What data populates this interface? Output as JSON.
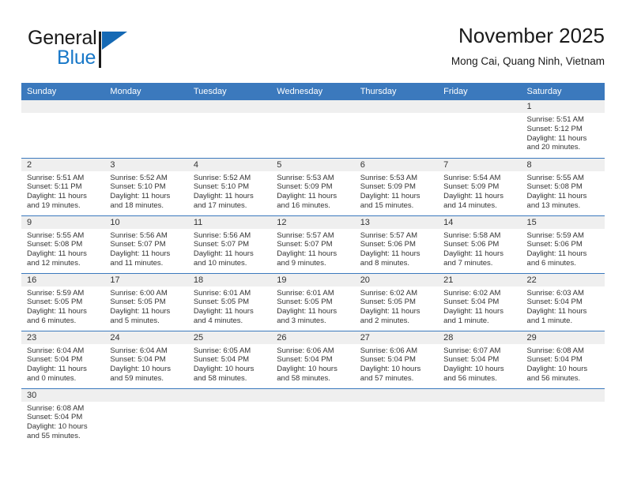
{
  "brand": {
    "name_top": "General",
    "name_bottom": "Blue",
    "logo_icon": "blue-triangle-logo",
    "accent_color": "#1878c8"
  },
  "header": {
    "title": "November 2025",
    "subtitle": "Mong Cai, Quang Ninh, Vietnam"
  },
  "calendar": {
    "header_bg": "#3b79bd",
    "daynum_bg": "#efefef",
    "weekdays": [
      "Sunday",
      "Monday",
      "Tuesday",
      "Wednesday",
      "Thursday",
      "Friday",
      "Saturday"
    ],
    "weeks": [
      [
        {
          "day": "",
          "blank": true,
          "sunrise": "",
          "sunset": "",
          "daylight_1": "",
          "daylight_2": ""
        },
        {
          "day": "",
          "blank": true,
          "sunrise": "",
          "sunset": "",
          "daylight_1": "",
          "daylight_2": ""
        },
        {
          "day": "",
          "blank": true,
          "sunrise": "",
          "sunset": "",
          "daylight_1": "",
          "daylight_2": ""
        },
        {
          "day": "",
          "blank": true,
          "sunrise": "",
          "sunset": "",
          "daylight_1": "",
          "daylight_2": ""
        },
        {
          "day": "",
          "blank": true,
          "sunrise": "",
          "sunset": "",
          "daylight_1": "",
          "daylight_2": ""
        },
        {
          "day": "",
          "blank": true,
          "sunrise": "",
          "sunset": "",
          "daylight_1": "",
          "daylight_2": ""
        },
        {
          "day": "1",
          "blank": false,
          "sunrise": "Sunrise: 5:51 AM",
          "sunset": "Sunset: 5:12 PM",
          "daylight_1": "Daylight: 11 hours",
          "daylight_2": "and 20 minutes."
        }
      ],
      [
        {
          "day": "2",
          "blank": false,
          "sunrise": "Sunrise: 5:51 AM",
          "sunset": "Sunset: 5:11 PM",
          "daylight_1": "Daylight: 11 hours",
          "daylight_2": "and 19 minutes."
        },
        {
          "day": "3",
          "blank": false,
          "sunrise": "Sunrise: 5:52 AM",
          "sunset": "Sunset: 5:10 PM",
          "daylight_1": "Daylight: 11 hours",
          "daylight_2": "and 18 minutes."
        },
        {
          "day": "4",
          "blank": false,
          "sunrise": "Sunrise: 5:52 AM",
          "sunset": "Sunset: 5:10 PM",
          "daylight_1": "Daylight: 11 hours",
          "daylight_2": "and 17 minutes."
        },
        {
          "day": "5",
          "blank": false,
          "sunrise": "Sunrise: 5:53 AM",
          "sunset": "Sunset: 5:09 PM",
          "daylight_1": "Daylight: 11 hours",
          "daylight_2": "and 16 minutes."
        },
        {
          "day": "6",
          "blank": false,
          "sunrise": "Sunrise: 5:53 AM",
          "sunset": "Sunset: 5:09 PM",
          "daylight_1": "Daylight: 11 hours",
          "daylight_2": "and 15 minutes."
        },
        {
          "day": "7",
          "blank": false,
          "sunrise": "Sunrise: 5:54 AM",
          "sunset": "Sunset: 5:09 PM",
          "daylight_1": "Daylight: 11 hours",
          "daylight_2": "and 14 minutes."
        },
        {
          "day": "8",
          "blank": false,
          "sunrise": "Sunrise: 5:55 AM",
          "sunset": "Sunset: 5:08 PM",
          "daylight_1": "Daylight: 11 hours",
          "daylight_2": "and 13 minutes."
        }
      ],
      [
        {
          "day": "9",
          "blank": false,
          "sunrise": "Sunrise: 5:55 AM",
          "sunset": "Sunset: 5:08 PM",
          "daylight_1": "Daylight: 11 hours",
          "daylight_2": "and 12 minutes."
        },
        {
          "day": "10",
          "blank": false,
          "sunrise": "Sunrise: 5:56 AM",
          "sunset": "Sunset: 5:07 PM",
          "daylight_1": "Daylight: 11 hours",
          "daylight_2": "and 11 minutes."
        },
        {
          "day": "11",
          "blank": false,
          "sunrise": "Sunrise: 5:56 AM",
          "sunset": "Sunset: 5:07 PM",
          "daylight_1": "Daylight: 11 hours",
          "daylight_2": "and 10 minutes."
        },
        {
          "day": "12",
          "blank": false,
          "sunrise": "Sunrise: 5:57 AM",
          "sunset": "Sunset: 5:07 PM",
          "daylight_1": "Daylight: 11 hours",
          "daylight_2": "and 9 minutes."
        },
        {
          "day": "13",
          "blank": false,
          "sunrise": "Sunrise: 5:57 AM",
          "sunset": "Sunset: 5:06 PM",
          "daylight_1": "Daylight: 11 hours",
          "daylight_2": "and 8 minutes."
        },
        {
          "day": "14",
          "blank": false,
          "sunrise": "Sunrise: 5:58 AM",
          "sunset": "Sunset: 5:06 PM",
          "daylight_1": "Daylight: 11 hours",
          "daylight_2": "and 7 minutes."
        },
        {
          "day": "15",
          "blank": false,
          "sunrise": "Sunrise: 5:59 AM",
          "sunset": "Sunset: 5:06 PM",
          "daylight_1": "Daylight: 11 hours",
          "daylight_2": "and 6 minutes."
        }
      ],
      [
        {
          "day": "16",
          "blank": false,
          "sunrise": "Sunrise: 5:59 AM",
          "sunset": "Sunset: 5:05 PM",
          "daylight_1": "Daylight: 11 hours",
          "daylight_2": "and 6 minutes."
        },
        {
          "day": "17",
          "blank": false,
          "sunrise": "Sunrise: 6:00 AM",
          "sunset": "Sunset: 5:05 PM",
          "daylight_1": "Daylight: 11 hours",
          "daylight_2": "and 5 minutes."
        },
        {
          "day": "18",
          "blank": false,
          "sunrise": "Sunrise: 6:01 AM",
          "sunset": "Sunset: 5:05 PM",
          "daylight_1": "Daylight: 11 hours",
          "daylight_2": "and 4 minutes."
        },
        {
          "day": "19",
          "blank": false,
          "sunrise": "Sunrise: 6:01 AM",
          "sunset": "Sunset: 5:05 PM",
          "daylight_1": "Daylight: 11 hours",
          "daylight_2": "and 3 minutes."
        },
        {
          "day": "20",
          "blank": false,
          "sunrise": "Sunrise: 6:02 AM",
          "sunset": "Sunset: 5:05 PM",
          "daylight_1": "Daylight: 11 hours",
          "daylight_2": "and 2 minutes."
        },
        {
          "day": "21",
          "blank": false,
          "sunrise": "Sunrise: 6:02 AM",
          "sunset": "Sunset: 5:04 PM",
          "daylight_1": "Daylight: 11 hours",
          "daylight_2": "and 1 minute."
        },
        {
          "day": "22",
          "blank": false,
          "sunrise": "Sunrise: 6:03 AM",
          "sunset": "Sunset: 5:04 PM",
          "daylight_1": "Daylight: 11 hours",
          "daylight_2": "and 1 minute."
        }
      ],
      [
        {
          "day": "23",
          "blank": false,
          "sunrise": "Sunrise: 6:04 AM",
          "sunset": "Sunset: 5:04 PM",
          "daylight_1": "Daylight: 11 hours",
          "daylight_2": "and 0 minutes."
        },
        {
          "day": "24",
          "blank": false,
          "sunrise": "Sunrise: 6:04 AM",
          "sunset": "Sunset: 5:04 PM",
          "daylight_1": "Daylight: 10 hours",
          "daylight_2": "and 59 minutes."
        },
        {
          "day": "25",
          "blank": false,
          "sunrise": "Sunrise: 6:05 AM",
          "sunset": "Sunset: 5:04 PM",
          "daylight_1": "Daylight: 10 hours",
          "daylight_2": "and 58 minutes."
        },
        {
          "day": "26",
          "blank": false,
          "sunrise": "Sunrise: 6:06 AM",
          "sunset": "Sunset: 5:04 PM",
          "daylight_1": "Daylight: 10 hours",
          "daylight_2": "and 58 minutes."
        },
        {
          "day": "27",
          "blank": false,
          "sunrise": "Sunrise: 6:06 AM",
          "sunset": "Sunset: 5:04 PM",
          "daylight_1": "Daylight: 10 hours",
          "daylight_2": "and 57 minutes."
        },
        {
          "day": "28",
          "blank": false,
          "sunrise": "Sunrise: 6:07 AM",
          "sunset": "Sunset: 5:04 PM",
          "daylight_1": "Daylight: 10 hours",
          "daylight_2": "and 56 minutes."
        },
        {
          "day": "29",
          "blank": false,
          "sunrise": "Sunrise: 6:08 AM",
          "sunset": "Sunset: 5:04 PM",
          "daylight_1": "Daylight: 10 hours",
          "daylight_2": "and 56 minutes."
        }
      ],
      [
        {
          "day": "30",
          "blank": false,
          "sunrise": "Sunrise: 6:08 AM",
          "sunset": "Sunset: 5:04 PM",
          "daylight_1": "Daylight: 10 hours",
          "daylight_2": "and 55 minutes."
        },
        {
          "day": "",
          "blank": true,
          "sunrise": "",
          "sunset": "",
          "daylight_1": "",
          "daylight_2": ""
        },
        {
          "day": "",
          "blank": true,
          "sunrise": "",
          "sunset": "",
          "daylight_1": "",
          "daylight_2": ""
        },
        {
          "day": "",
          "blank": true,
          "sunrise": "",
          "sunset": "",
          "daylight_1": "",
          "daylight_2": ""
        },
        {
          "day": "",
          "blank": true,
          "sunrise": "",
          "sunset": "",
          "daylight_1": "",
          "daylight_2": ""
        },
        {
          "day": "",
          "blank": true,
          "sunrise": "",
          "sunset": "",
          "daylight_1": "",
          "daylight_2": ""
        },
        {
          "day": "",
          "blank": true,
          "sunrise": "",
          "sunset": "",
          "daylight_1": "",
          "daylight_2": ""
        }
      ]
    ]
  }
}
